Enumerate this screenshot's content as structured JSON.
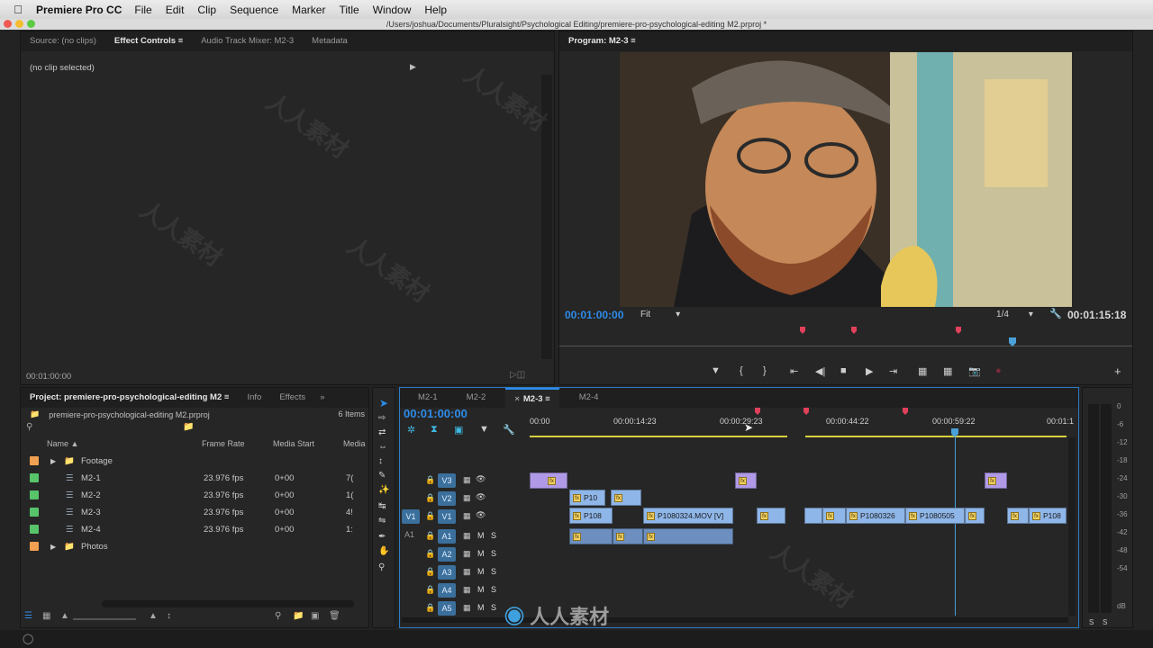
{
  "menubar": {
    "app_name": "Premiere Pro CC",
    "items": [
      "File",
      "Edit",
      "Clip",
      "Sequence",
      "Marker",
      "Title",
      "Window",
      "Help"
    ]
  },
  "window": {
    "path": "/Users/joshua/Documents/Pluralsight/Psychological Editing/premiere-pro-psychological-editing M2.prproj *"
  },
  "source_panel": {
    "tabs": [
      "Source: (no clips)",
      "Effect Controls",
      "Audio Track Mixer: M2-3",
      "Metadata"
    ],
    "active_tab": "Effect Controls",
    "empty_text": "(no clip selected)",
    "timecode": "00:01:00:00"
  },
  "program_monitor": {
    "title": "Program: M2-3",
    "timecode": "00:01:00:00",
    "zoom": "Fit",
    "resolution": "1/4",
    "duration": "00:01:15:18"
  },
  "project_panel": {
    "tabs": [
      "Project: premiere-pro-psychological-editing M2",
      "Info",
      "Effects"
    ],
    "file_name": "premiere-pro-psychological-editing M2.prproj",
    "item_count": "6 Items",
    "columns": [
      "Name",
      "Frame Rate",
      "Media Start",
      "Media"
    ],
    "rows": [
      {
        "name": "Footage",
        "type": "folder",
        "color": "#f0a050",
        "frame_rate": "",
        "media_start": "",
        "media": ""
      },
      {
        "name": "M2-1",
        "type": "sequence",
        "color": "#58c46a",
        "frame_rate": "23.976 fps",
        "media_start": "0+00",
        "media": "7("
      },
      {
        "name": "M2-2",
        "type": "sequence",
        "color": "#58c46a",
        "frame_rate": "23.976 fps",
        "media_start": "0+00",
        "media": "1("
      },
      {
        "name": "M2-3",
        "type": "sequence",
        "color": "#58c46a",
        "frame_rate": "23.976 fps",
        "media_start": "0+00",
        "media": "4!"
      },
      {
        "name": "M2-4",
        "type": "sequence",
        "color": "#58c46a",
        "frame_rate": "23.976 fps",
        "media_start": "0+00",
        "media": "1:"
      },
      {
        "name": "Photos",
        "type": "folder",
        "color": "#f0a050",
        "frame_rate": "",
        "media_start": "",
        "media": ""
      }
    ]
  },
  "timeline": {
    "tabs": [
      "M2-1",
      "M2-2",
      "M2-3",
      "M2-4"
    ],
    "active_tab": "M2-3",
    "timecode": "00:01:00:00",
    "ruler": [
      "00:00",
      "00:00:14:23",
      "00:00:29:23",
      "00:00:44:22",
      "00:00:59:22",
      "00:01:1"
    ],
    "video_tracks": [
      "V3",
      "V2",
      "V1"
    ],
    "source_patch_video": "V1",
    "source_patch_audio": "A1",
    "audio_tracks": [
      "A1",
      "A2",
      "A3",
      "A4",
      "A5"
    ],
    "mute_label": "M",
    "solo_label": "S",
    "clips": {
      "v2_a": "P10",
      "v1_a": "P108",
      "v1_b": "P1080324.MOV [V]",
      "v1_c": "P1080326",
      "v1_d": "P1080505",
      "v1_e": "P108"
    },
    "fx_label": "fx"
  },
  "audio_meter": {
    "db_labels": [
      "0",
      "-6",
      "-12",
      "-18",
      "-24",
      "-30",
      "-36",
      "-42",
      "-48",
      "-54",
      "dB"
    ],
    "solo_labels": [
      "S",
      "S"
    ]
  },
  "watermark": "人人素材"
}
